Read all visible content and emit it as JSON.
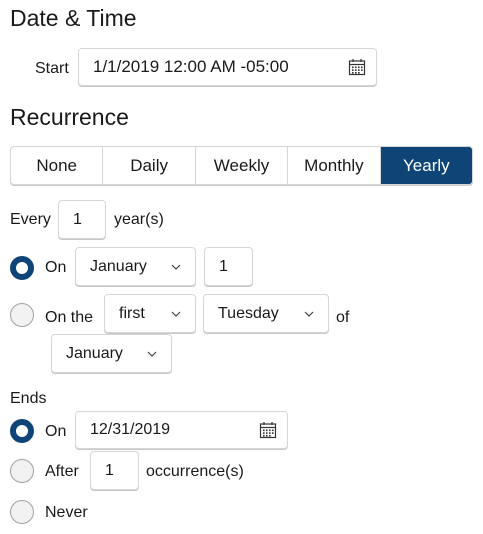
{
  "date_time": {
    "heading": "Date & Time",
    "start_label": "Start",
    "start_value": "1/1/2019 12:00 AM -05:00"
  },
  "recurrence": {
    "heading": "Recurrence",
    "options": [
      "None",
      "Daily",
      "Weekly",
      "Monthly",
      "Yearly"
    ],
    "selected": "Yearly",
    "every_label": "Every",
    "every_value": "1",
    "every_unit": "year(s)",
    "on_label": "On",
    "on_month": "January",
    "on_day": "1",
    "on_the_label": "On the",
    "on_the_ordinal": "first",
    "on_the_weekday": "Tuesday",
    "of_label": "of",
    "on_the_month": "January",
    "selected_mode": "On"
  },
  "ends": {
    "heading": "Ends",
    "on_label": "On",
    "on_date": "12/31/2019",
    "after_label": "After",
    "after_value": "1",
    "after_unit": "occurrence(s)",
    "never_label": "Never",
    "selected_mode": "On"
  },
  "colors": {
    "accent": "#0e4476",
    "border": "#d6d6d6"
  },
  "icons": {
    "calendar": "calendar-icon",
    "dropdown": "chevron-down-icon"
  }
}
